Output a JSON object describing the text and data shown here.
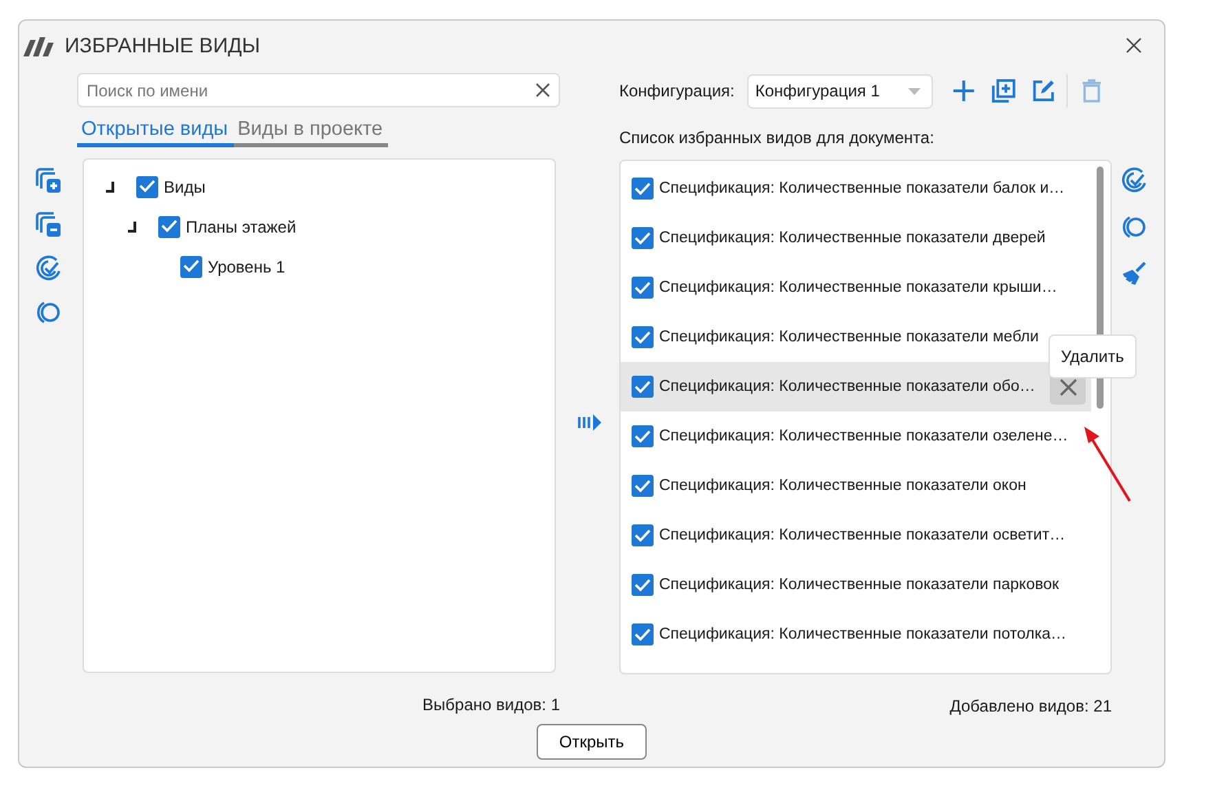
{
  "window": {
    "title": "ИЗБРАННЫЕ ВИДЫ"
  },
  "search": {
    "placeholder": "Поиск по имени"
  },
  "tabs": [
    {
      "label": "Открытые виды",
      "selected": true
    },
    {
      "label": "Виды в проекте",
      "selected": false
    }
  ],
  "left_tools": [
    {
      "kind": "add"
    },
    {
      "kind": "remove"
    },
    {
      "kind": "check"
    },
    {
      "kind": "uncheck"
    }
  ],
  "tree": [
    {
      "label": "Виды",
      "checked": true,
      "expanded": true,
      "children": [
        {
          "label": "Планы этажей",
          "checked": true,
          "expanded": true,
          "children": [
            {
              "label": "Уровень 1",
              "checked": true
            }
          ]
        }
      ]
    }
  ],
  "selected_count": "Выбрано видов: 1",
  "config": {
    "label": "Конфигурация:",
    "value": "Конфигурация 1"
  },
  "config_tools": [
    {
      "kind": "plus",
      "disabled": false
    },
    {
      "kind": "copy",
      "disabled": false
    },
    {
      "kind": "edit",
      "disabled": false
    },
    {
      "kind": "delete",
      "disabled": true
    }
  ],
  "list_label": "Список избранных видов для документа:",
  "list": [
    {
      "label": "Спецификация: Количественные показатели балок и…",
      "checked": true,
      "hovered": false
    },
    {
      "label": "Спецификация: Количественные показатели дверей",
      "checked": true,
      "hovered": false
    },
    {
      "label": "Спецификация: Количественные показатели крыши…",
      "checked": true,
      "hovered": false
    },
    {
      "label": "Спецификация: Количественные показатели мебли",
      "checked": true,
      "hovered": false
    },
    {
      "label": "Спецификация: Количественные показатели обо…",
      "checked": true,
      "hovered": true
    },
    {
      "label": "Спецификация: Количественные показатели озелене…",
      "checked": true,
      "hovered": false
    },
    {
      "label": "Спецификация: Количественные показатели окон",
      "checked": true,
      "hovered": false
    },
    {
      "label": "Спецификация: Количественные показатели осветит…",
      "checked": true,
      "hovered": false
    },
    {
      "label": "Спецификация: Количественные показатели парковок",
      "checked": true,
      "hovered": false
    },
    {
      "label": "Спецификация: Количественные показатели потолка…",
      "checked": true,
      "hovered": false
    }
  ],
  "right_tools": [
    {
      "kind": "check"
    },
    {
      "kind": "uncheck"
    },
    {
      "kind": "clear"
    }
  ],
  "tooltip": "Удалить",
  "added_count": "Добавлено видов: 21",
  "open_button": "Открыть"
}
